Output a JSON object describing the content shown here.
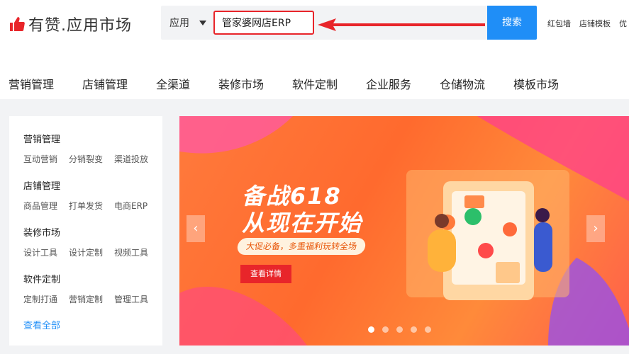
{
  "brand": {
    "logo_text": "有赞.应用市场",
    "accent": "#e8252a"
  },
  "search": {
    "type_label": "应用",
    "query": "管家婆网店ERP",
    "button_label": "搜索",
    "button_color": "#1f8ef7"
  },
  "quick_links": [
    "红包墙",
    "店铺模板",
    "优"
  ],
  "nav": [
    "营销管理",
    "店铺管理",
    "全渠道",
    "装修市场",
    "软件定制",
    "企业服务",
    "仓储物流",
    "模板市场"
  ],
  "sidebar": {
    "categories": [
      {
        "title": "营销管理",
        "items": [
          "互动营销",
          "分销裂变",
          "渠道投放"
        ]
      },
      {
        "title": "店铺管理",
        "items": [
          "商品管理",
          "打单发货",
          "电商ERP"
        ]
      },
      {
        "title": "装修市场",
        "items": [
          "设计工具",
          "设计定制",
          "视频工具"
        ]
      },
      {
        "title": "软件定制",
        "items": [
          "定制打通",
          "营销定制",
          "管理工具"
        ]
      }
    ],
    "view_all": "查看全部"
  },
  "banner": {
    "title_line1": "备战618",
    "title_line2": "从现在开始",
    "subtitle": "大促必备，多重福利玩转全场",
    "cta": "查看详情",
    "prev_icon": "‹",
    "next_icon": "›",
    "dot_count": 5,
    "active_dot": 0
  }
}
